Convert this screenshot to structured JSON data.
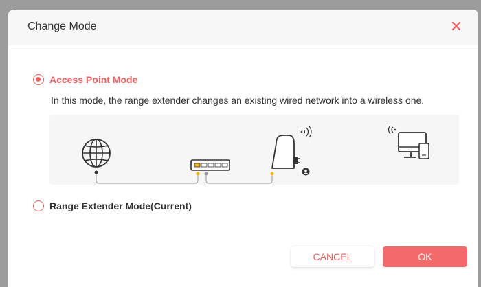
{
  "dialog": {
    "title": "Change Mode",
    "close_icon": "close-icon"
  },
  "modes": [
    {
      "label": "Access Point Mode",
      "selected": true,
      "description": "In this mode, the range extender changes an existing wired network into a wireless one."
    },
    {
      "label": "Range Extender Mode(Current)",
      "selected": false
    }
  ],
  "diagram": {
    "icons": [
      "globe-icon",
      "switch-icon",
      "extender-icon",
      "computer-phone-icon"
    ]
  },
  "buttons": {
    "cancel_label": "CANCEL",
    "ok_label": "OK"
  },
  "colors": {
    "accent": "#f25c5c",
    "ok_button": "#f46a6a"
  }
}
